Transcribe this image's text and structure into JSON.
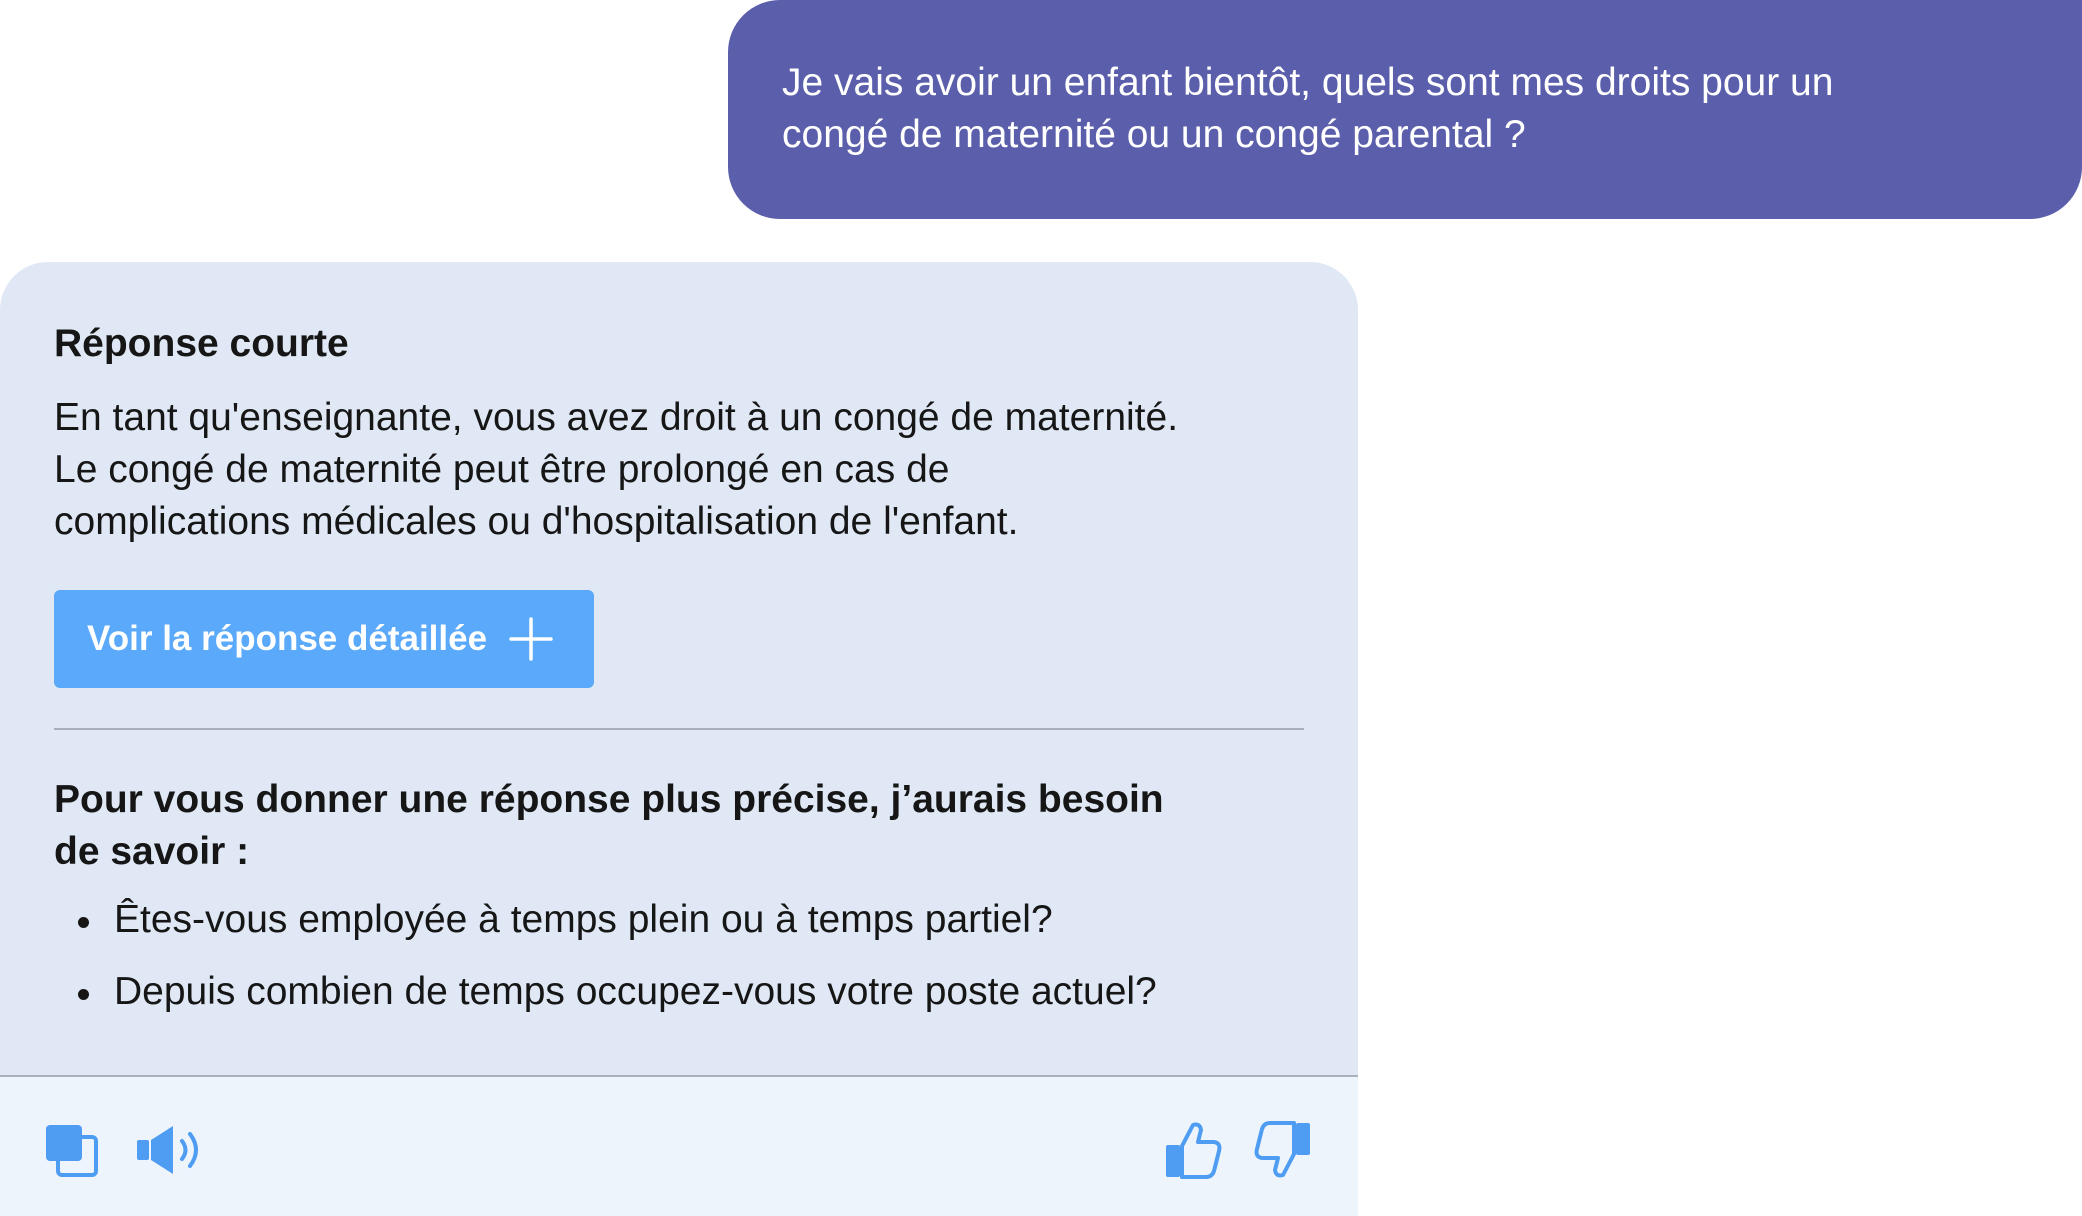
{
  "user_message": {
    "lines": [
      "Je vais avoir un enfant bientôt, quels sont mes droits pour un",
      "congé de maternité ou un congé parental ?"
    ]
  },
  "assistant": {
    "short_title": "Réponse courte",
    "short_lines": [
      "En tant qu'enseignante, vous avez droit à un congé de maternité.",
      "Le congé de maternité peut être prolongé en cas de",
      "complications médicales ou d'hospitalisation de l'enfant."
    ],
    "detail_button_label": "Voir la réponse détaillée",
    "question_title_lines": [
      "Pour vous donner une réponse plus précise, j’aurais besoin",
      "de savoir :"
    ],
    "questions": [
      "Êtes-vous employée à temps plein ou à temps partiel?",
      "Depuis combien de temps occupez-vous votre poste actuel?"
    ]
  },
  "toolbar": {
    "icons": [
      "copy-icon",
      "speaker-icon",
      "thumbs-up-icon",
      "thumbs-down-icon"
    ]
  },
  "colors": {
    "user_bubble": "#5b5fab",
    "card_background": "#dfe8f4",
    "footer_background": "#edf4fc",
    "accent": "#5aa9fa"
  }
}
